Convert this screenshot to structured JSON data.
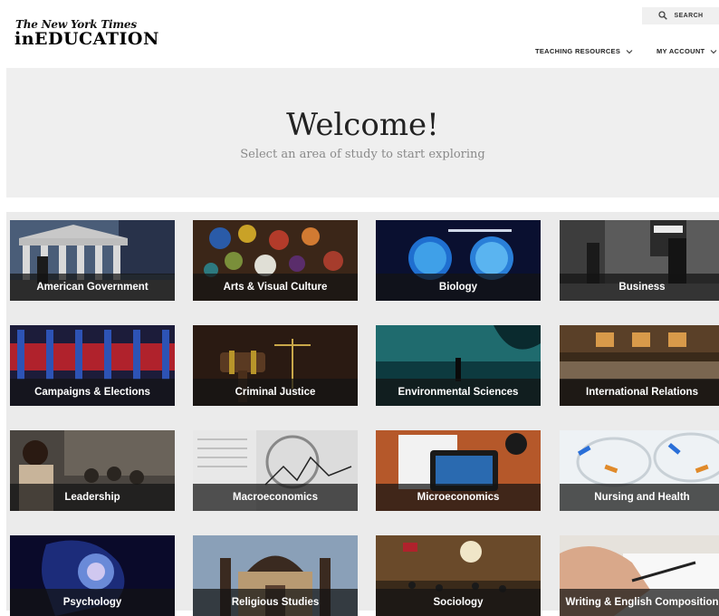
{
  "header": {
    "logo_top": "The New York Times",
    "logo_main": "inEDUCATION",
    "search_label": "SEARCH",
    "nav": [
      {
        "label": "TEACHING RESOURCES"
      },
      {
        "label": "MY ACCOUNT"
      }
    ]
  },
  "hero": {
    "title": "Welcome!",
    "subtitle": "Select an area of study to start exploring"
  },
  "subjects": [
    {
      "label": "American Government"
    },
    {
      "label": "Arts & Visual Culture"
    },
    {
      "label": "Biology"
    },
    {
      "label": "Business"
    },
    {
      "label": "Campaigns & Elections"
    },
    {
      "label": "Criminal Justice"
    },
    {
      "label": "Environmental Sciences"
    },
    {
      "label": "International Relations"
    },
    {
      "label": "Leadership"
    },
    {
      "label": "Macroeconomics"
    },
    {
      "label": "Microeconomics"
    },
    {
      "label": "Nursing and Health"
    },
    {
      "label": "Psychology"
    },
    {
      "label": "Religious Studies"
    },
    {
      "label": "Sociology"
    },
    {
      "label": "Writing & English Composition"
    }
  ]
}
